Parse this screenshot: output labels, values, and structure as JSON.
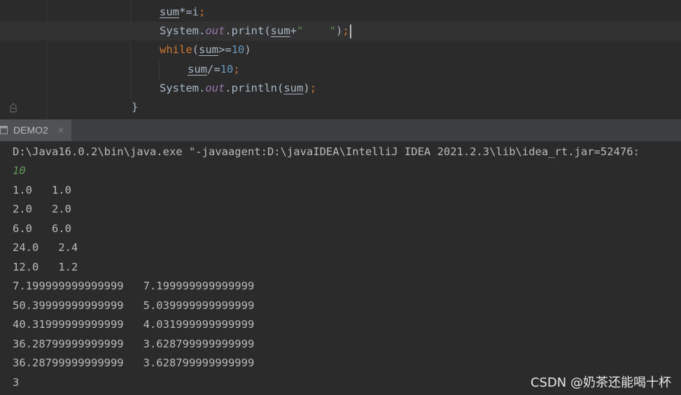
{
  "editor": {
    "lines": {
      "l1": {
        "var": "sum",
        "op": "*=i",
        "semi": ";"
      },
      "l2": {
        "cls": "System",
        "dot1": ".",
        "field": "out",
        "call": ".print(",
        "var": "sum",
        "plus": "+",
        "str": "\"    \"",
        "close": ")",
        "semi": ";"
      },
      "l3": {
        "kw": "while",
        "open": "(",
        "var": "sum",
        "op": ">=",
        "num": "10",
        "close": ")"
      },
      "l4": {
        "var": "sum",
        "op": "/=",
        "num": "10",
        "semi": ";"
      },
      "l5": {
        "cls": "System",
        "dot1": ".",
        "field": "out",
        "call": ".println(",
        "var": "sum",
        "close": ")",
        "semi": ";"
      },
      "l6": {
        "brace": "}"
      }
    }
  },
  "run_panel": {
    "tab_label": "DEMO2",
    "tab_close": "×",
    "tab_icon": "console-window-icon"
  },
  "console": {
    "command": "D:\\Java16.0.2\\bin\\java.exe \"-javaagent:D:\\javaIDEA\\IntelliJ IDEA 2021.2.3\\lib\\idea_rt.jar=52476:",
    "user_input": "10",
    "output": [
      "1.0   1.0",
      "2.0   2.0",
      "6.0   6.0",
      "24.0   2.4",
      "12.0   1.2",
      "7.199999999999999   7.199999999999999",
      "50.39999999999999   5.039999999999999",
      "40.31999999999999   4.031999999999999",
      "36.28799999999999   3.628799999999999",
      "36.28799999999999   3.628799999999999",
      "3"
    ]
  },
  "watermark": "CSDN @奶茶还能喝十杯",
  "colors": {
    "editor_bg": "#2b2b2b",
    "keyword": "#cc7832",
    "number": "#6897bb",
    "string": "#6a8759",
    "field": "#9876aa",
    "console_input": "#629755"
  }
}
